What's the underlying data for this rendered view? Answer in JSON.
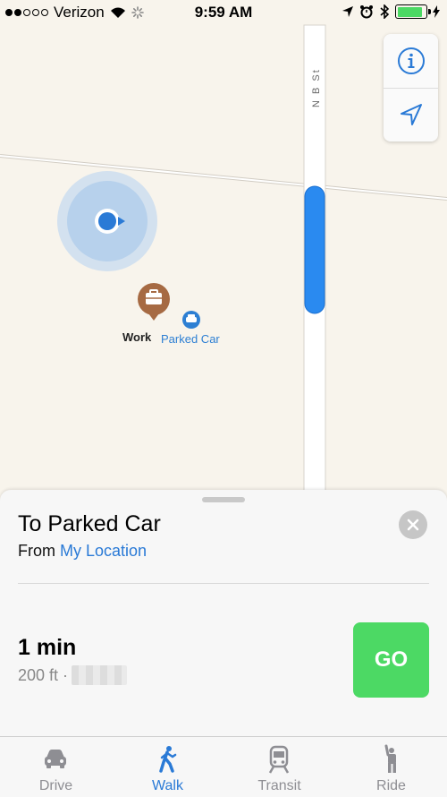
{
  "status_bar": {
    "carrier": "Verizon",
    "time": "9:59 AM",
    "signal_bars_filled": 2,
    "signal_bars_total": 5,
    "battery_level": 0.9
  },
  "map": {
    "road_label": "N B St",
    "pins": [
      {
        "label": "Work",
        "icon": "briefcase-icon",
        "color": "#a66a43"
      },
      {
        "label": "Parked Car",
        "icon": "car-icon",
        "color": "#2d7fd3"
      }
    ],
    "controls": {
      "info_icon": "info-icon",
      "location_icon": "location-arrow-icon"
    }
  },
  "sheet": {
    "title": "To Parked Car",
    "from_prefix": "From",
    "from_link": "My Location",
    "eta": "1 min",
    "distance": "200 ft ·",
    "go_label": "GO"
  },
  "tabs": [
    {
      "label": "Drive",
      "icon": "car-icon",
      "active": false
    },
    {
      "label": "Walk",
      "icon": "walk-icon",
      "active": true
    },
    {
      "label": "Transit",
      "icon": "train-icon",
      "active": false
    },
    {
      "label": "Ride",
      "icon": "ride-hail-icon",
      "active": false
    }
  ],
  "colors": {
    "accent": "#2a7ad6",
    "go": "#4cd964",
    "route": "#2a8af0",
    "map_bg": "#f8f4ec"
  }
}
